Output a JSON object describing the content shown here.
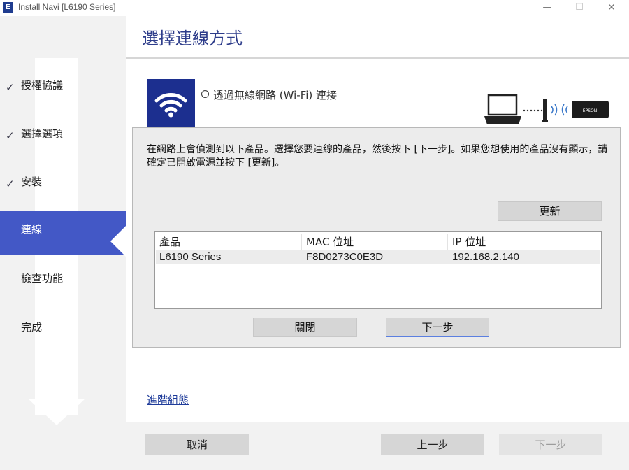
{
  "window": {
    "app_icon": "E",
    "title": "Install Navi [L6190 Series]",
    "minimize_glyph": "—",
    "maximize_glyph": "☐",
    "close_glyph": "✕"
  },
  "sidebar": {
    "check_glyph": "✓",
    "steps": [
      {
        "label": "授權協議",
        "done": true
      },
      {
        "label": "選擇選項",
        "done": true
      },
      {
        "label": "安裝",
        "done": true
      },
      {
        "label": "連線",
        "active": true
      },
      {
        "label": "檢查功能"
      },
      {
        "label": "完成"
      }
    ]
  },
  "header": {
    "title": "選擇連線方式"
  },
  "option": {
    "icon": "wifi-icon",
    "label": "透過無線網路 (Wi-Fi) 連接",
    "diagram_brand": "EPSON"
  },
  "dialog": {
    "message": "在網路上會偵測到以下產品。選擇您要連線的產品，然後按下 [下一步]。如果您想使用的產品沒有顯示，請確定已開啟電源並按下 [更新]。",
    "refresh_label": "更新",
    "table": {
      "headers": [
        "產品",
        "MAC 位址",
        "IP 位址"
      ],
      "rows": [
        [
          "L6190 Series",
          "F8D0273C0E3D",
          "192.168.2.140"
        ]
      ]
    },
    "close_label": "關閉",
    "next_label": "下一步"
  },
  "advanced_link": "進階組態",
  "footer": {
    "cancel_label": "取消",
    "back_label": "上一步",
    "next_label": "下一步"
  },
  "colors": {
    "accent": "#4358c6",
    "title": "#2d3c8a",
    "wifi_box": "#1c2f8f"
  }
}
